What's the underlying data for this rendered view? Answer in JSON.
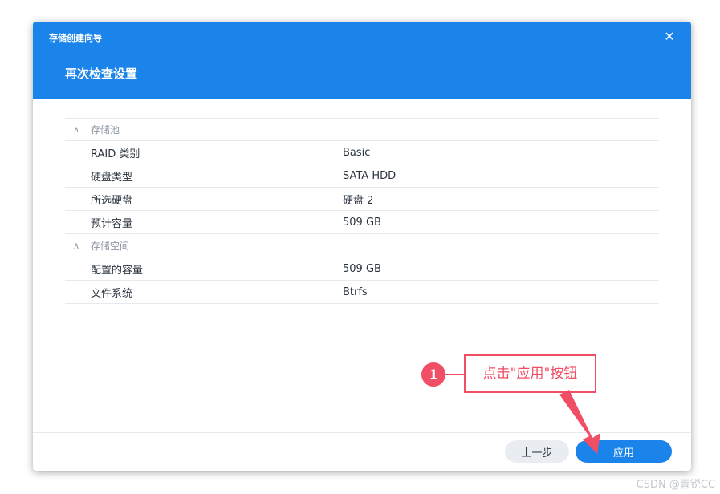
{
  "window": {
    "title": "存储创建向导",
    "close_glyph": "✕",
    "page_title": "再次检查设置"
  },
  "sections": [
    {
      "chevron": "∧",
      "name": "存储池",
      "rows": [
        {
          "label": "RAID 类别",
          "value": "Basic"
        },
        {
          "label": "硬盘类型",
          "value": "SATA HDD"
        },
        {
          "label": "所选硬盘",
          "value": "硬盘 2"
        },
        {
          "label": "预计容量",
          "value": "509 GB"
        }
      ]
    },
    {
      "chevron": "∧",
      "name": "存储空间",
      "rows": [
        {
          "label": "配置的容量",
          "value": "509 GB"
        },
        {
          "label": "文件系统",
          "value": "Btrfs"
        }
      ]
    }
  ],
  "footer": {
    "back_label": "上一步",
    "apply_label": "应用"
  },
  "annotation": {
    "step": "1",
    "text": "点击\"应用\"按钮",
    "color": "#f04e64"
  },
  "watermark": "CSDN @青锐CC",
  "colors": {
    "accent": "#1a84ea"
  }
}
